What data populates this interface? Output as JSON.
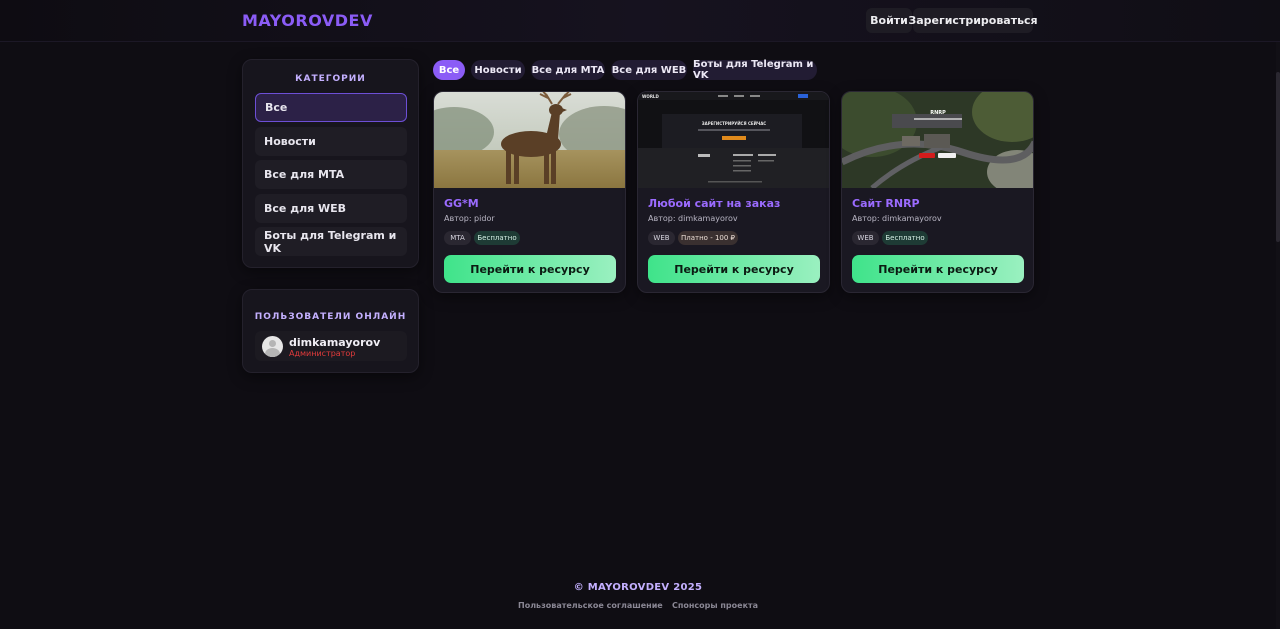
{
  "header": {
    "logo": "MAYOROVDEV",
    "login_label": "Войти",
    "register_label": "Зарегистрироваться"
  },
  "sidebar": {
    "categories_title": "КАТЕГОРИИ",
    "categories": [
      {
        "label": "Все",
        "active": true
      },
      {
        "label": "Новости",
        "active": false
      },
      {
        "label": "Все для MTA",
        "active": false
      },
      {
        "label": "Все для WEB",
        "active": false
      },
      {
        "label": "Боты для Telegram и VK",
        "active": false
      }
    ],
    "users_title": "ПОЛЬЗОВАТЕЛИ ОНЛАЙН",
    "users": [
      {
        "name": "dimkamayorov",
        "role": "Администратор",
        "avatar_icon": "user-avatar-icon"
      }
    ]
  },
  "filters": [
    {
      "label": "Все",
      "active": true
    },
    {
      "label": "Новости",
      "active": false
    },
    {
      "label": "Все для MTA",
      "active": false
    },
    {
      "label": "Все для WEB",
      "active": false
    },
    {
      "label": "Боты для Telegram и VK",
      "active": false
    }
  ],
  "cards": [
    {
      "title": "GG*M",
      "author": "Автор: pidor",
      "type": "MTA",
      "price": "Бесплатно",
      "button": "Перейти к ресурсу"
    },
    {
      "title": "Любой сайт на заказ",
      "author": "Автор: dimkamayorov",
      "type": "WEB",
      "price": "Платно - 100 ₽",
      "button": "Перейти к ресурсу",
      "preview": {
        "brand": "WORLD",
        "headline": "ЗАРЕГИСТРИРУЙСЯ СЕЙЧАС"
      }
    },
    {
      "title": "Сайт RNRP",
      "author": "Автор: dimkamayorov",
      "type": "WEB",
      "price": "Бесплатно",
      "button": "Перейти к ресурсу",
      "preview": {
        "brand": "RNRP"
      }
    }
  ],
  "footer": {
    "copyright": "© MAYOROVDEV 2025",
    "links": [
      "Пользовательское соглашение",
      "Спонсоры проекта"
    ]
  },
  "colors": {
    "accent": "#8b5cf6",
    "button_gradient_start": "#3fe38a",
    "button_gradient_end": "#9af0c0",
    "role_color": "#e23b3b"
  }
}
